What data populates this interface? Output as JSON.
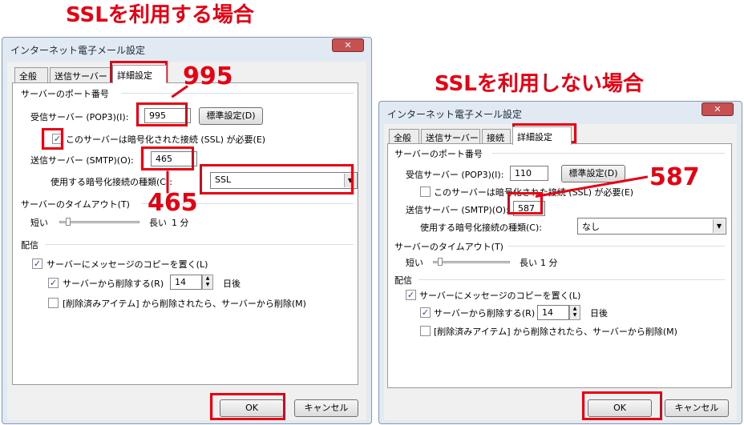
{
  "headings": {
    "left": "SSLを利用する場合",
    "right": "SSLを利用しない場合"
  },
  "callouts": {
    "left_pop": "995",
    "left_smtp": "465",
    "right_smtp": "587"
  },
  "colors": {
    "annotation": "#e60012",
    "dialog_frame": "#e1e9f2"
  },
  "left_dialog": {
    "title": "インターネット電子メール設定",
    "close": "✕",
    "tabs": [
      "全般",
      "送信サーバー",
      "詳細設定"
    ],
    "port_section": "サーバーのポート番号",
    "pop_label": "受信サーバー (POP3)(I):",
    "pop_value": "995",
    "default_button": "標準設定(D)",
    "ssl_check_label": "このサーバーは暗号化された接続 (SSL) が必要(E)",
    "ssl_checked": "✓",
    "smtp_label": "送信サーバー (SMTP)(O):",
    "smtp_value": "465",
    "enc_label": "使用する暗号化接続の種類(C):",
    "enc_value": "SSL",
    "timeout_section": "サーバーのタイムアウト(T)",
    "short": "短い",
    "long": "長い",
    "timeout_value": "1 分",
    "delivery_section": "配信",
    "leave_copy": "サーバーにメッセージのコピーを置く(L)",
    "leave_copy_checked": "✓",
    "remove_after": "サーバーから削除する(R)",
    "remove_after_checked": "✓",
    "days_value": "14",
    "days_unit": "日後",
    "remove_deleted": "[削除済みアイテム] から削除されたら、サーバーから削除(M)",
    "ok": "OK",
    "cancel": "キャンセル"
  },
  "right_dialog": {
    "title": "インターネット電子メール設定",
    "close": "✕",
    "tabs": [
      "全般",
      "送信サーバー",
      "接続",
      "詳細設定"
    ],
    "port_section": "サーバーのポート番号",
    "pop_label": "受信サーバー (POP3)(I):",
    "pop_value": "110",
    "default_button": "標準設定(D)",
    "ssl_check_label": "このサーバーは暗号化された接続 (SSL) が必要(E)",
    "smtp_label": "送信サーバー (SMTP)(O):",
    "smtp_value": "587",
    "enc_label": "使用する暗号化接続の種類(C):",
    "enc_value": "なし",
    "timeout_section": "サーバーのタイムアウト(T)",
    "short": "短い",
    "long": "長い",
    "timeout_value": "1 分",
    "delivery_section": "配信",
    "leave_copy": "サーバーにメッセージのコピーを置く(L)",
    "leave_copy_checked": "✓",
    "remove_after": "サーバーから削除する(R)",
    "remove_after_checked": "✓",
    "days_value": "14",
    "days_unit": "日後",
    "remove_deleted": "[削除済みアイテム] から削除されたら、サーバーから削除(M)",
    "ok": "OK",
    "cancel": "キャンセル"
  }
}
